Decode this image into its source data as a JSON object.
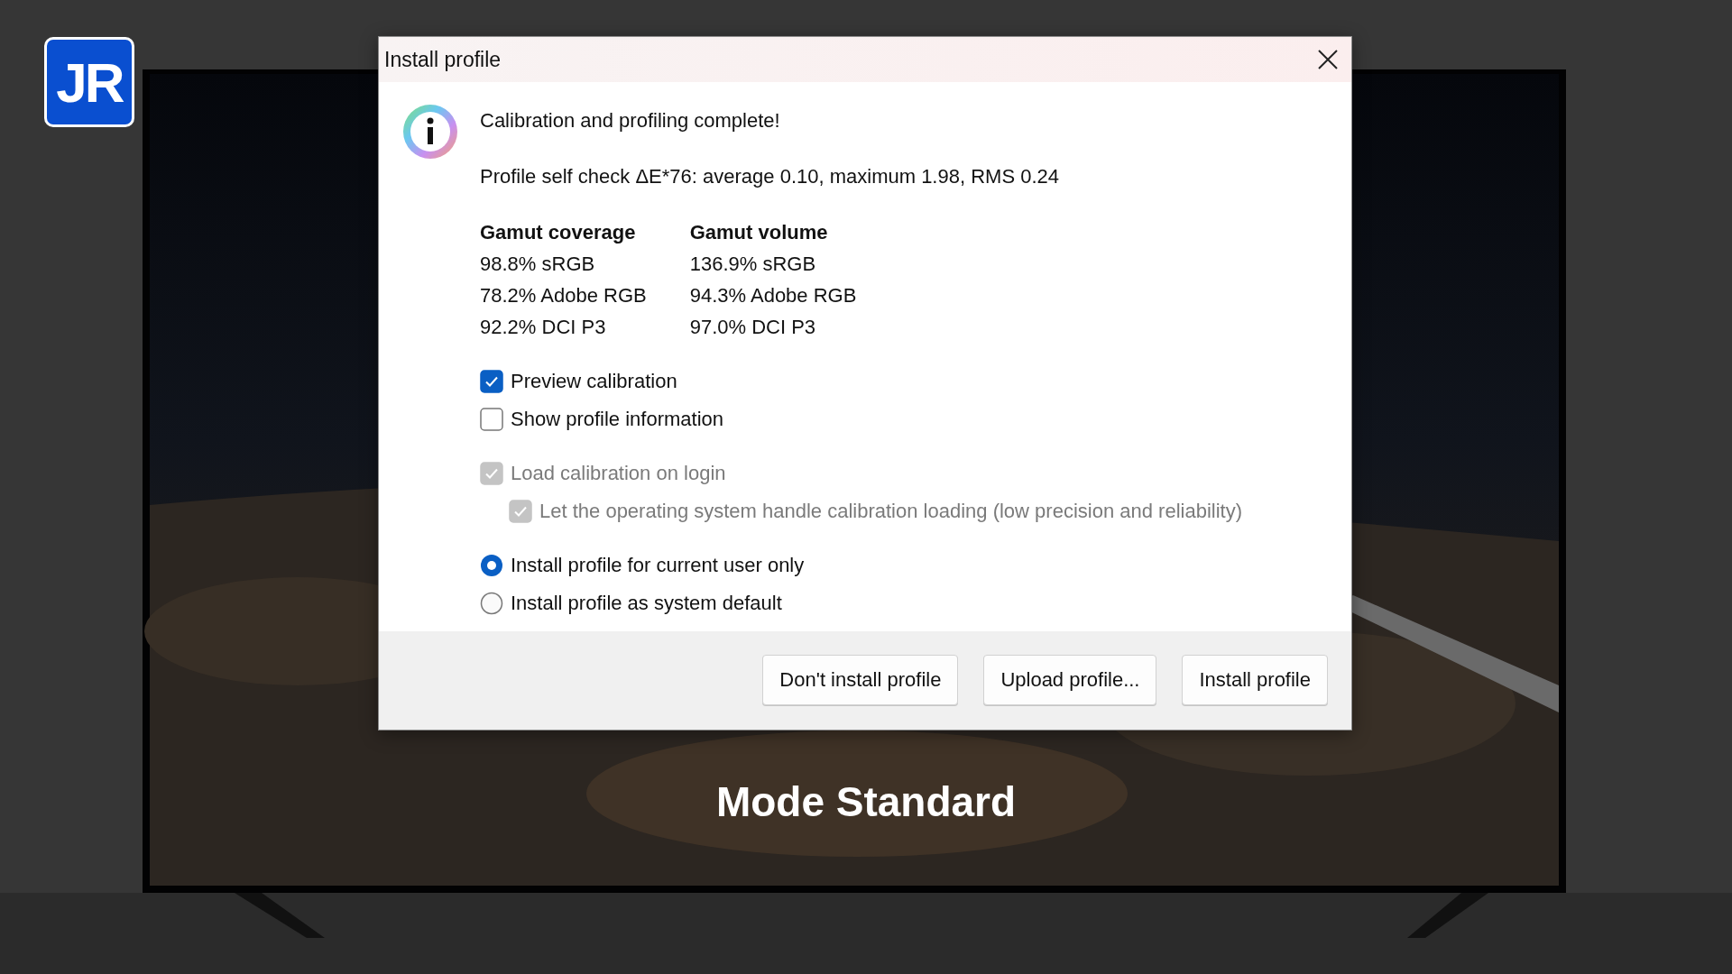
{
  "logo": {
    "text": "JR"
  },
  "dialog": {
    "title": "Install profile",
    "heading": "Calibration and profiling complete!",
    "self_check": "Profile self check ΔE*76: average 0.10, maximum 1.98, RMS 0.24",
    "gamut": [
      {
        "header": "Gamut coverage",
        "rows": [
          "98.8% sRGB",
          "78.2% Adobe RGB",
          "92.2% DCI P3"
        ]
      },
      {
        "header": "Gamut volume",
        "rows": [
          "136.9% sRGB",
          "94.3% Adobe RGB",
          "97.0% DCI P3"
        ]
      }
    ],
    "option_groups": [
      {
        "items": [
          {
            "kind": "checkbox",
            "label": "Preview calibration",
            "checked": true,
            "disabled": false
          },
          {
            "kind": "checkbox",
            "label": "Show profile information",
            "checked": false,
            "disabled": false
          }
        ]
      },
      {
        "items": [
          {
            "kind": "checkbox",
            "label": "Load calibration on login",
            "checked": true,
            "disabled": true,
            "children": [
              {
                "kind": "checkbox",
                "label": "Let the operating system handle calibration loading (low precision and reliability)",
                "checked": true,
                "disabled": true
              }
            ]
          }
        ]
      },
      {
        "items": [
          {
            "kind": "radio",
            "label": "Install profile for current user only",
            "selected": true
          },
          {
            "kind": "radio",
            "label": "Install profile as system default",
            "selected": false
          }
        ]
      }
    ],
    "buttons": [
      "Don't install profile",
      "Upload profile...",
      "Install profile"
    ]
  },
  "caption": "Mode Standard"
}
